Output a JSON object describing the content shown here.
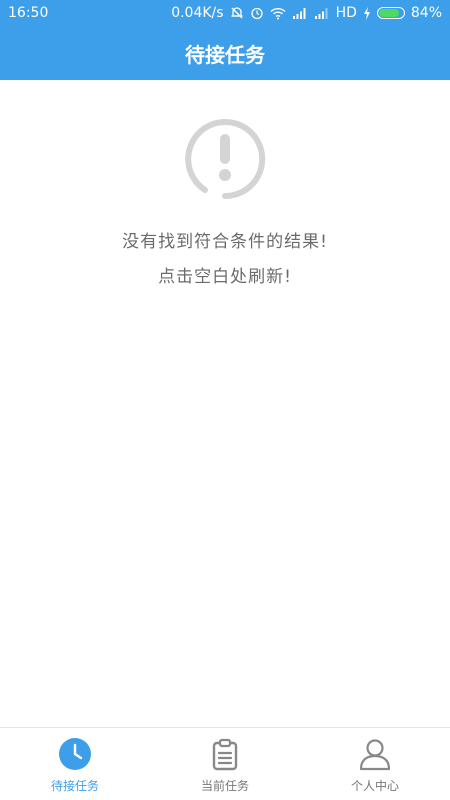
{
  "status_bar": {
    "time": "16:50",
    "network_speed": "0.04K/s",
    "network_type": "HD",
    "battery_percent": "84%",
    "battery_level": 0.84,
    "icons": [
      "bell-muted-icon",
      "alarm-icon",
      "wifi-icon",
      "signal-icon",
      "signal-icon",
      "charging-icon",
      "battery-icon"
    ]
  },
  "header": {
    "title": "待接任务"
  },
  "empty_state": {
    "icon": "exclamation-circle-icon",
    "message": "没有找到符合条件的结果!",
    "hint": "点击空白处刷新!"
  },
  "tabbar": {
    "tabs": [
      {
        "label": "待接任务",
        "icon": "clock-icon",
        "active": true
      },
      {
        "label": "当前任务",
        "icon": "clipboard-icon",
        "active": false
      },
      {
        "label": "个人中心",
        "icon": "person-icon",
        "active": false
      }
    ]
  },
  "colors": {
    "brand": "#3d9ee9",
    "icon_gray": "#d4d4d4",
    "text_gray": "#6b6b6b",
    "battery_green": "#4cd964"
  }
}
